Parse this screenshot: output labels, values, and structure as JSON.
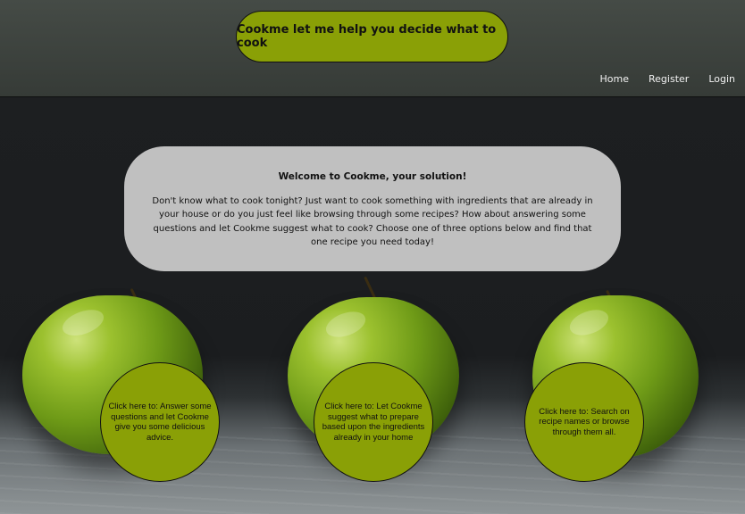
{
  "header": {
    "title": "Cookme let me help you decide what to cook",
    "nav": [
      {
        "label": "Home"
      },
      {
        "label": "Register"
      },
      {
        "label": "Login"
      }
    ]
  },
  "welcome": {
    "heading": "Welcome to Cookme, your solution!",
    "body": "Don't know what to cook tonight? Just want to cook something with ingredients that are already in your house or do you just feel like browsing through some recipes? How about answering some questions and let Cookme suggest what to cook? Choose one of three options below and find that one recipe you need today!"
  },
  "options": [
    {
      "label": "Click here to: Answer some questions and let Cookme give you some delicious advice."
    },
    {
      "label": "Click here to: Let Cookme suggest what to prepare based upon the ingredients already in your home"
    },
    {
      "label": "Click here to: Search on recipe names or browse through them all."
    }
  ],
  "colors": {
    "accent": "#8aa006",
    "header_bg": "#3d423e",
    "panel_bg": "#c0c0c0"
  }
}
